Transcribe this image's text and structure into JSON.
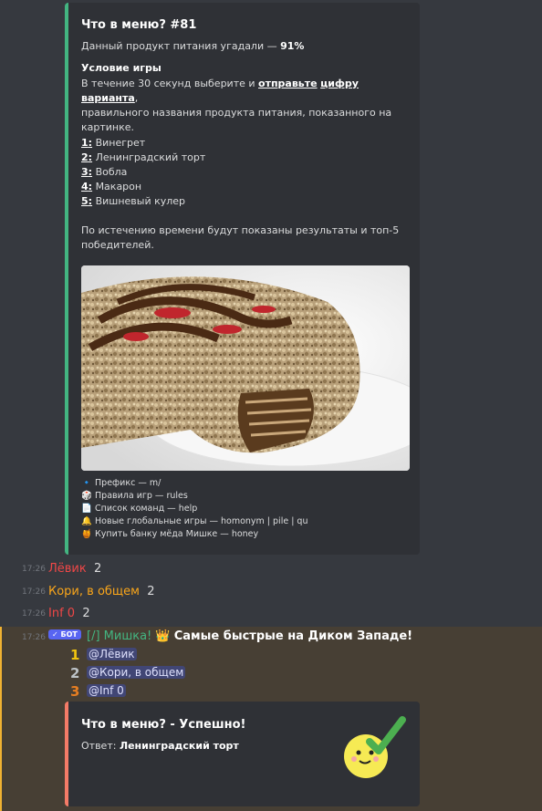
{
  "quiz": {
    "title": "Что в меню? #81",
    "guessed_prefix": "Данный продукт питания угадали — ",
    "guessed_pct": "91%",
    "cond_title": "Условие игры",
    "cond_1": "В течение 30 секунд выберите и ",
    "cond_send": "отправьте",
    "cond_digit": "цифру",
    "cond_variant": "варианта",
    "cond_2": ",",
    "cond_3": "правильного названия продукта питания, показанного на",
    "cond_4": "картинке.",
    "options": [
      {
        "num": "1",
        "text": "Винегрет"
      },
      {
        "num": "2",
        "text": "Ленинградский торт"
      },
      {
        "num": "3",
        "text": "Вобла"
      },
      {
        "num": "4",
        "text": "Макарон"
      },
      {
        "num": "5",
        "text": "Вишневый кулер"
      }
    ],
    "results_1": "По истечению времени будут показаны результаты и топ-5",
    "results_2": "победителей.",
    "footer": [
      {
        "icon": "🔹",
        "icon_name": "blue-diamond-icon",
        "text": "Префикс — m/"
      },
      {
        "icon": "🎲",
        "icon_name": "dice-icon",
        "text": "Правила игр — rules"
      },
      {
        "icon": "📄",
        "icon_name": "page-icon",
        "text": "Список команд — help"
      },
      {
        "icon": "🔔",
        "icon_name": "bell-icon",
        "text": "Новые глобальные игры — homonym | pile | qu"
      },
      {
        "icon": "🍯",
        "icon_name": "honey-pot-icon",
        "text": "Купить банку мёда Мишке — honey"
      }
    ]
  },
  "messages": [
    {
      "time": "17:26",
      "user": "Лёвик",
      "color": "#f04747",
      "text": "2"
    },
    {
      "time": "17:26",
      "user": "Кори, в общем",
      "color": "#faa61a",
      "text": "2"
    },
    {
      "time": "17:26",
      "user": "Inf 0",
      "color": "#f04747",
      "text": "2"
    }
  ],
  "bot": {
    "time": "17:26",
    "badge": "✓ БОТ",
    "name": "[/] Мишка!",
    "name_color": "#43b581",
    "crown": "👑",
    "headline": "Самые быстрые на Диком Западе!",
    "winners": [
      {
        "place": "1",
        "color": "#f1c40f",
        "name": "@Лёвик"
      },
      {
        "place": "2",
        "color": "#bdc3c7",
        "name": "@Кори, в общем"
      },
      {
        "place": "3",
        "color": "#e67e22",
        "name": "@Inf 0"
      }
    ]
  },
  "result": {
    "title": "Что в меню? - Успешно!",
    "answer_label": "Ответ: ",
    "answer": "Ленинградский торт"
  }
}
